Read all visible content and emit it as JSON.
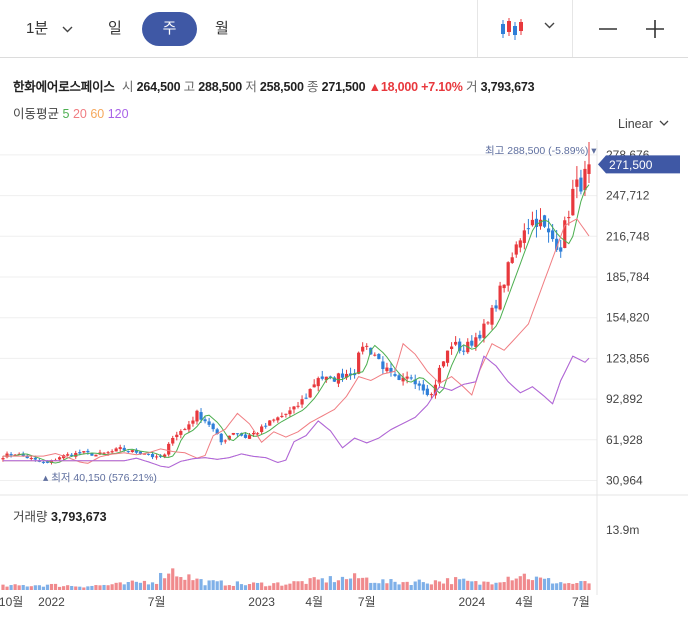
{
  "toolbar": {
    "period_minute": "1분",
    "period_day": "일",
    "period_week": "주",
    "period_month": "월",
    "selected": "주"
  },
  "stock": {
    "name": "한화에어로스페이스",
    "open_label": "시",
    "open": "264,500",
    "high_label": "고",
    "high": "288,500",
    "low_label": "저",
    "low": "258,500",
    "close_label": "종",
    "close": "271,500",
    "change": "18,000",
    "change_pct": "+7.10%",
    "volume_label": "거",
    "volume": "3,793,673"
  },
  "ma_legend": {
    "label": "이동평균",
    "periods": [
      "5",
      "20",
      "60",
      "120"
    ]
  },
  "scale_mode": "Linear",
  "volume_panel": {
    "label": "거래량",
    "value": "3,793,673",
    "axis_tick": "13.9m"
  },
  "colors": {
    "up": "#e8383d",
    "down": "#2f7fd8",
    "ma5": "#4caf50",
    "ma20": "#f07d82",
    "ma60": "#f5a85c",
    "ma120": "#a964e8",
    "accent": "#3f58a5"
  },
  "chart_data": {
    "type": "candlestick",
    "interval": "weekly",
    "y_ticks": [
      30964,
      61928,
      92892,
      123856,
      154820,
      185784,
      216748,
      247712,
      278676
    ],
    "y_tick_labels": [
      "30,964",
      "61,928",
      "92,892",
      "123,856",
      "154,820",
      "185,784",
      "216,748",
      "247,712",
      "278,676"
    ],
    "ylim": [
      26000,
      288500
    ],
    "current_price": 271500,
    "current_price_label": "271,500",
    "max_label": "최고",
    "max_value": "288,500 (-5.89%)",
    "max_price": 288500,
    "min_label": "최저",
    "min_value": "40,150 (576.21%)",
    "min_price": 40150,
    "x_tick_labels": [
      "10월",
      "2022",
      "7월",
      "2023",
      "4월",
      "7월",
      "2024",
      "4월",
      "7월"
    ],
    "x_tick_index": [
      2,
      12,
      38,
      64,
      77,
      90,
      116,
      129,
      143
    ],
    "close_anchors": [
      [
        0,
        49500
      ],
      [
        3,
        51500
      ],
      [
        6,
        48500
      ],
      [
        9,
        45000
      ],
      [
        11,
        44000
      ],
      [
        14,
        49000
      ],
      [
        17,
        51000
      ],
      [
        20,
        52000
      ],
      [
        23,
        50500
      ],
      [
        26,
        52000
      ],
      [
        29,
        55000
      ],
      [
        32,
        53000
      ],
      [
        35,
        52000
      ],
      [
        38,
        48000
      ],
      [
        40,
        50000
      ],
      [
        42,
        65000
      ],
      [
        45,
        70000
      ],
      [
        48,
        82000
      ],
      [
        51,
        74000
      ],
      [
        54,
        60000
      ],
      [
        57,
        68000
      ],
      [
        60,
        64000
      ],
      [
        63,
        68000
      ],
      [
        66,
        75000
      ],
      [
        69,
        80000
      ],
      [
        72,
        85000
      ],
      [
        75,
        95000
      ],
      [
        78,
        110000
      ],
      [
        81,
        107000
      ],
      [
        84,
        112000
      ],
      [
        87,
        114000
      ],
      [
        89,
        135000
      ],
      [
        92,
        127000
      ],
      [
        95,
        114000
      ],
      [
        98,
        105000
      ],
      [
        101,
        110000
      ],
      [
        104,
        102000
      ],
      [
        106,
        96000
      ],
      [
        108,
        115000
      ],
      [
        111,
        135000
      ],
      [
        114,
        130000
      ],
      [
        117,
        140000
      ],
      [
        120,
        150000
      ],
      [
        123,
        175000
      ],
      [
        126,
        200000
      ],
      [
        129,
        225000
      ],
      [
        132,
        230000
      ],
      [
        135,
        217000
      ],
      [
        138,
        210000
      ],
      [
        141,
        250000
      ],
      [
        144,
        262000
      ],
      [
        145,
        271500
      ]
    ],
    "volume_anchors": [
      [
        0,
        0.6
      ],
      [
        10,
        0.8
      ],
      [
        20,
        0.6
      ],
      [
        30,
        0.9
      ],
      [
        38,
        1.5
      ],
      [
        41,
        3.2
      ],
      [
        45,
        2.2
      ],
      [
        50,
        1.2
      ],
      [
        60,
        0.9
      ],
      [
        70,
        1.0
      ],
      [
        80,
        1.6
      ],
      [
        88,
        1.9
      ],
      [
        95,
        1.2
      ],
      [
        105,
        1.3
      ],
      [
        112,
        1.5
      ],
      [
        118,
        1.0
      ],
      [
        124,
        1.9
      ],
      [
        128,
        2.4
      ],
      [
        133,
        1.6
      ],
      [
        140,
        1.0
      ],
      [
        145,
        1.1
      ]
    ],
    "volume_max": 13900000,
    "bar_count": 146
  }
}
